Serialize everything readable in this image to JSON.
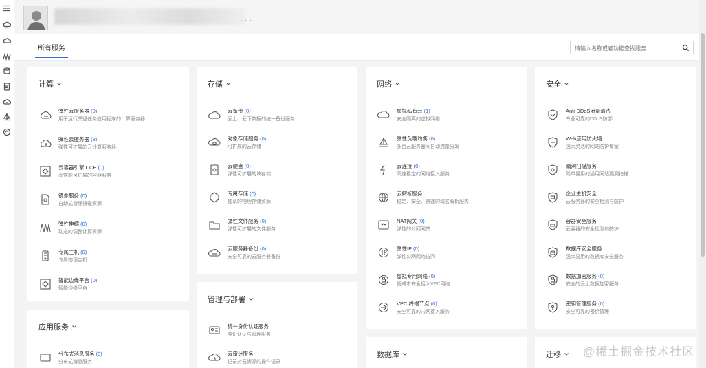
{
  "rail": {
    "icons": [
      "menu-icon",
      "cloud-server-icon",
      "cloud-icon",
      "elastic-icon",
      "database-icon",
      "document-icon",
      "cloud-outline-icon",
      "sail-icon",
      "refresh-icon"
    ]
  },
  "header": {
    "username": "████████████████████",
    "more": "· · ·"
  },
  "tabs": {
    "active": "所有服务"
  },
  "search": {
    "placeholder": "请输入名称或者功能查找服务"
  },
  "watermark": "@稀土掘金技术社区",
  "cards": [
    {
      "id": "compute",
      "title": "计算",
      "items": [
        {
          "icon": "ecs-icon",
          "name": "弹性云服务器",
          "count": "(0)",
          "desc": "用于运行关键任务应用程序的计算服务器"
        },
        {
          "icon": "bms-icon",
          "name": "弹性云服务器",
          "count": "(3)",
          "desc": "弹性可扩展的云计算服务器"
        },
        {
          "icon": "cce-icon",
          "name": "云容器引擎 CCE",
          "count": "(0)",
          "desc": "高性能可扩展的容器服务"
        },
        {
          "icon": "image-icon",
          "name": "镜像服务",
          "count": "(0)",
          "desc": "自助式管理镜像资源"
        },
        {
          "icon": "as-icon",
          "name": "弹性伸缩",
          "count": "(0)",
          "desc": "动态的调整计算资源"
        },
        {
          "icon": "dedicated-host-icon",
          "name": "专属主机",
          "count": "(0)",
          "desc": "专属物理主机"
        },
        {
          "icon": "edge-icon",
          "name": "智能边缘平台",
          "count": "(0)",
          "desc": "智能边缘平台"
        }
      ]
    },
    {
      "id": "app",
      "title": "应用服务",
      "items": [
        {
          "icon": "dms-icon",
          "name": "分布式消息服务",
          "count": "(0)",
          "desc": "分布式消息服务"
        }
      ]
    },
    {
      "id": "storage",
      "title": "存储",
      "items": [
        {
          "icon": "cbr-icon",
          "name": "云备份",
          "count": "(0)",
          "desc": "云上、云下数据的统一备份服务"
        },
        {
          "icon": "obs-icon",
          "name": "对象存储服务",
          "count": "(0)",
          "desc": "可扩展的云存储"
        },
        {
          "icon": "evs-icon",
          "name": "云硬盘",
          "count": "(0)",
          "desc": "弹性可扩展的块存储"
        },
        {
          "icon": "dss-icon",
          "name": "专属存储",
          "count": "(0)",
          "desc": "独享的物理存储资源"
        },
        {
          "icon": "sfs-icon",
          "name": "弹性文件服务",
          "count": "(0)",
          "desc": "弹性可扩展的文件服务"
        },
        {
          "icon": "csbs-icon",
          "name": "云服务器备份",
          "count": "(0)",
          "desc": "安全可靠的云服务器备份"
        }
      ]
    },
    {
      "id": "mgmt",
      "title": "管理与部署",
      "items": [
        {
          "icon": "iam-icon",
          "name": "统一身份认证服务",
          "count": "",
          "desc": "身份认证与管理服务"
        },
        {
          "icon": "cts-icon",
          "name": "云审计服务",
          "count": "",
          "desc": "记录对云资源的操作记录"
        }
      ]
    },
    {
      "id": "network",
      "title": "网络",
      "items": [
        {
          "icon": "vpc-icon",
          "name": "虚拟私有云",
          "count": "(1)",
          "desc": "安全隔离的虚拟网络"
        },
        {
          "icon": "elb-icon",
          "name": "弹性负载均衡",
          "count": "(0)",
          "desc": "多台云服务器间自动流量分发"
        },
        {
          "icon": "cc-icon",
          "name": "云连接",
          "count": "(0)",
          "desc": "高速稳定的网络接入服务"
        },
        {
          "icon": "dns-icon",
          "name": "云解析服务",
          "count": "",
          "desc": "稳定、安全、快速的域名解析服务"
        },
        {
          "icon": "nat-icon",
          "name": "NAT网关",
          "count": "(0)",
          "desc": "弹性的公网网关"
        },
        {
          "icon": "eip-icon",
          "name": "弹性IP",
          "count": "(0)",
          "desc": "弹性公网网络访问"
        },
        {
          "icon": "vpn-icon",
          "name": "虚拟专用网络",
          "count": "(0)",
          "desc": "低成本安全接入VPC网络"
        },
        {
          "icon": "vpcep-icon",
          "name": "VPC 终端节点",
          "count": "(0)",
          "desc": "安全可靠的内网接入服务"
        }
      ]
    },
    {
      "id": "db",
      "title": "数据库",
      "items": []
    },
    {
      "id": "security",
      "title": "安全",
      "items": [
        {
          "icon": "anti-ddos-icon",
          "name": "Anti-DDoS流量清洗",
          "count": "",
          "desc": "专业可靠的DDoS防御"
        },
        {
          "icon": "waf-icon",
          "name": "Web应用防火墙",
          "count": "",
          "desc": "强大灵活的网站防护专家"
        },
        {
          "icon": "vss-icon",
          "name": "漏洞扫描服务",
          "count": "",
          "desc": "简单易用的通用网站漏洞扫描"
        },
        {
          "icon": "hss-icon",
          "name": "企业主机安全",
          "count": "",
          "desc": "云服务器的安全检测与防护"
        },
        {
          "icon": "cgs-icon",
          "name": "容器安全服务",
          "count": "",
          "desc": "云容器的安全检测和防护"
        },
        {
          "icon": "dbss-icon",
          "name": "数据库安全服务",
          "count": "",
          "desc": "强大易用的数据库安全服务"
        },
        {
          "icon": "dew-icon",
          "name": "数据加密服务",
          "count": "(0)",
          "desc": "安全的云上数据加密服务"
        },
        {
          "icon": "kms-icon",
          "name": "密钥管理服务",
          "count": "(0)",
          "desc": "安全可靠的密钥管理"
        }
      ]
    },
    {
      "id": "migration",
      "title": "迁移",
      "items": []
    }
  ]
}
